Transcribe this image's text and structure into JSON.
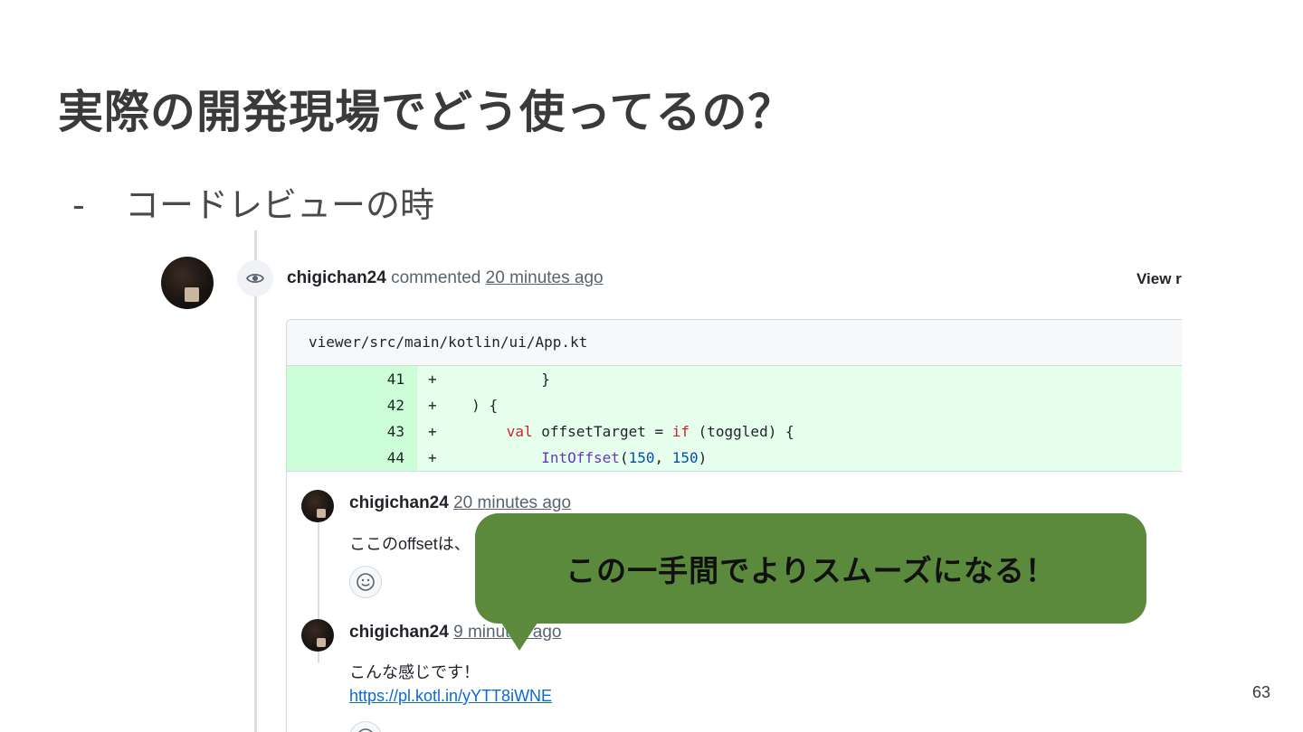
{
  "slide": {
    "title": "実際の開発現場でどう使ってるの？",
    "bullet_dash": "-",
    "bullet_text": "コードレビューの時",
    "page_number": "63"
  },
  "comment": {
    "author": "chigichan24",
    "action": "commented",
    "timestamp": "20 minutes ago",
    "view_link": "View r",
    "icon": "eye-icon"
  },
  "diff": {
    "file_path": "viewer/src/main/kotlin/ui/App.kt",
    "colors": {
      "added_line_bg": "#e6ffec",
      "added_num_bg": "#ccffd8",
      "keyword": "#cf222e",
      "function": "#6639ba",
      "number": "#0550ae"
    },
    "lines": [
      {
        "number": "41",
        "sign": "+",
        "indent": "            ",
        "text": "}"
      },
      {
        "number": "42",
        "sign": "+",
        "indent": "    ",
        "text": ") {"
      },
      {
        "number": "43",
        "sign": "+",
        "indent": "        ",
        "keyword": "val",
        "text_a": " offsetTarget = ",
        "keyword2": "if",
        "text_b": " (toggled) {"
      },
      {
        "number": "44",
        "sign": "+",
        "indent": "            ",
        "fn": "IntOffset",
        "paren_open": "(",
        "num1": "150",
        "comma": ", ",
        "num2": "150",
        "paren_close": ")"
      }
    ]
  },
  "replies": [
    {
      "author": "chigichan24",
      "timestamp": "20 minutes ago",
      "body": "ここのoffsetは、"
    },
    {
      "author": "chigichan24",
      "timestamp": "9 minutes ago",
      "body": "こんな感じです！",
      "link": "https://pl.kotl.in/yYTT8iWNE"
    }
  ],
  "callout": {
    "text": "この一手間でよりスムーズになる！",
    "color": "#5b8a3c"
  }
}
